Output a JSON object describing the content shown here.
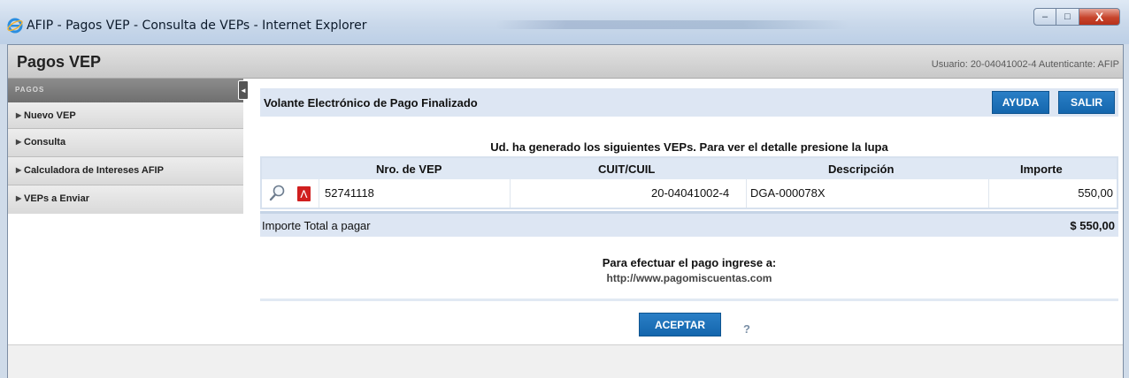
{
  "window": {
    "title": "AFIP - Pagos VEP - Consulta de VEPs - Internet Explorer",
    "controls": {
      "minimize": "‒",
      "maximize": "□",
      "close": "X"
    }
  },
  "header": {
    "app_title": "Pagos VEP",
    "user_info": "Usuario: 20-04041002-4 Autenticante: AFIP"
  },
  "sidebar": {
    "section_label": "PAGOS",
    "toggle_glyph": "◄",
    "items": [
      {
        "label": "Nuevo VEP"
      },
      {
        "label": "Consulta"
      },
      {
        "label": "Calculadora de Intereses AFIP"
      },
      {
        "label": "VEPs a Enviar"
      }
    ]
  },
  "main": {
    "panel_title": "Volante Electrónico de Pago Finalizado",
    "help_button": "AYUDA",
    "exit_button": "SALIR",
    "intro_text": "Ud. ha generado los siguientes VEPs. Para ver el detalle presione la lupa",
    "table": {
      "columns": [
        "Nro. de VEP",
        "CUIT/CUIL",
        "Descripción",
        "Importe"
      ],
      "rows": [
        {
          "nro": "52741118",
          "cuit": "20-04041002-4",
          "descripcion": "DGA-000078X",
          "importe": "550,00"
        }
      ]
    },
    "total_label": "Importe Total a pagar",
    "total_value": "$ 550,00",
    "pago_text": "Para efectuar el pago ingrese a:",
    "pago_url": "http://www.pagomiscuentas.com",
    "accept_button": "ACEPTAR",
    "help_glyph": "?"
  },
  "colors": {
    "accent_button": "#1e73b8",
    "panel_bg": "#dde6f3",
    "close_button": "#c7442c"
  }
}
